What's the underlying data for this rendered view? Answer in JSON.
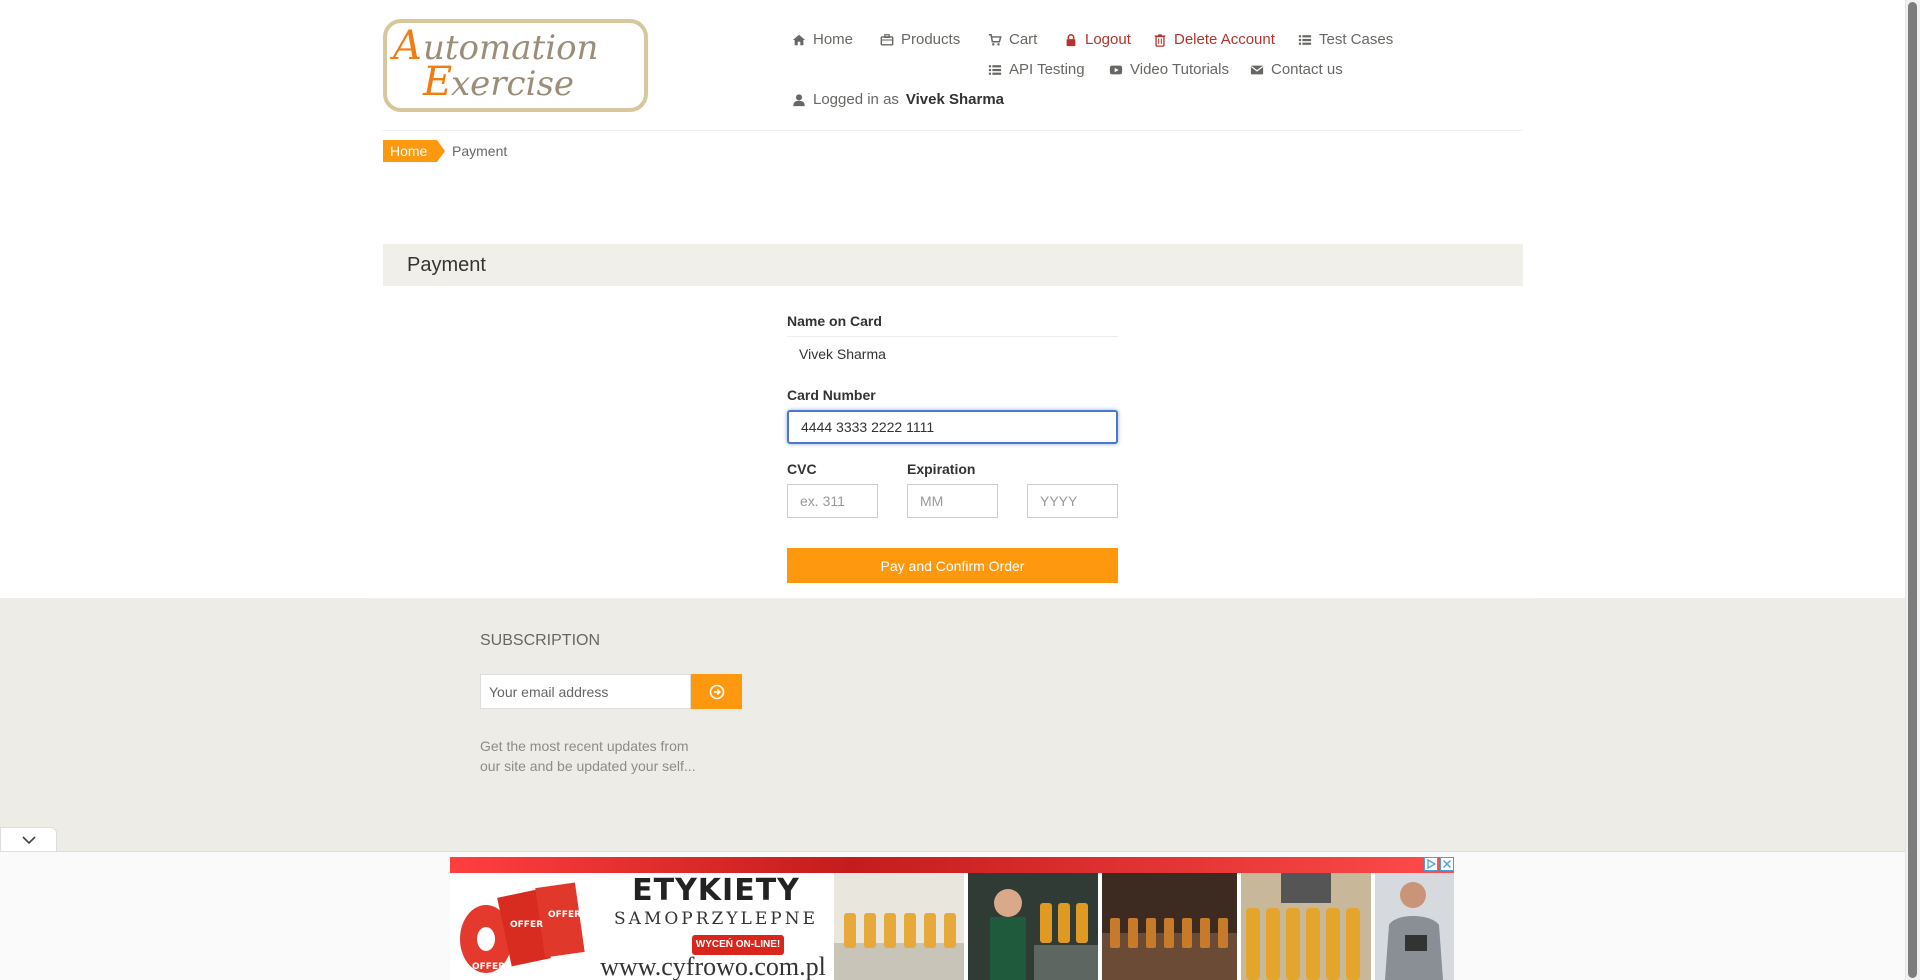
{
  "header": {
    "logo_text": "Automation Exercise",
    "nav": {
      "home": "Home",
      "products": "Products",
      "cart": "Cart",
      "logout": "Logout",
      "delete_account": "Delete Account",
      "test_cases": "Test Cases",
      "api_testing": "API Testing",
      "video_tutorials": "Video Tutorials",
      "contact_us": "Contact us",
      "logged_in_prefix": "Logged in as",
      "logged_in_user": "Vivek Sharma"
    }
  },
  "breadcrumb": {
    "home": "Home",
    "current": "Payment"
  },
  "payment": {
    "heading": "Payment",
    "name_label": "Name on Card",
    "name_value": "Vivek Sharma",
    "card_label": "Card Number",
    "card_value": "4444 3333 2222 1111",
    "cvc_label": "CVC",
    "cvc_placeholder": "ex. 311",
    "expiration_label": "Expiration",
    "month_placeholder": "MM",
    "year_placeholder": "YYYY",
    "submit_label": "Pay and Confirm Order"
  },
  "footer": {
    "subscription_title": "SUBSCRIPTION",
    "email_placeholder": "Your email address",
    "subscription_text": "Get the most recent updates from our site and be updated your self..."
  },
  "ad": {
    "title": "ETYKIETY",
    "subtitle": "SAMOPRZYLEPNE",
    "cta": "WYCEŃ ON-LINE!",
    "url": "www.cyfrowo.com.pl",
    "roll_label": "OFFER"
  },
  "colors": {
    "accent": "#fe980f",
    "danger": "#b6322c",
    "footer_bg": "#edece6",
    "focus": "#4a78d1"
  },
  "icons": [
    "home-icon",
    "briefcase-icon",
    "cart-icon",
    "lock-icon",
    "trash-icon",
    "list-icon",
    "youtube-icon",
    "envelope-icon",
    "user-icon",
    "arrow-circle-right-icon",
    "chevron-down-icon",
    "adchoices-icon",
    "close-icon"
  ]
}
